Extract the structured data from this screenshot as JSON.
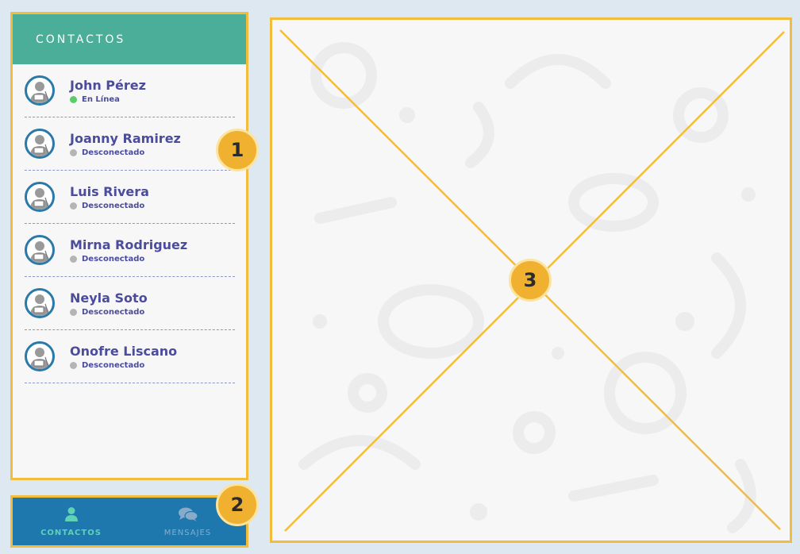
{
  "contacts": {
    "title": "CONTACTOS",
    "items": [
      {
        "name": "John Pérez",
        "status": "En Línea",
        "status_color": "#5ccb6a"
      },
      {
        "name": "Joanny Ramirez",
        "status": "Desconectado",
        "status_color": "#b5b5b5"
      },
      {
        "name": "Luis Rivera",
        "status": "Desconectado",
        "status_color": "#b5b5b5"
      },
      {
        "name": "Mirna Rodriguez",
        "status": "Desconectado",
        "status_color": "#b5b5b5"
      },
      {
        "name": "Neyla Soto",
        "status": "Desconectado",
        "status_color": "#b5b5b5"
      },
      {
        "name": "Onofre Liscano",
        "status": "Desconectado",
        "status_color": "#b5b5b5"
      }
    ]
  },
  "nav": {
    "contacts_label": "CONTACTOS",
    "contacts_icon": "user-icon",
    "messages_label": "MENSAJES",
    "messages_icon": "chat-bubbles-icon"
  },
  "badges": {
    "one": "1",
    "two": "2",
    "three": "3"
  },
  "colors": {
    "header": "#4bae98",
    "nav": "#1e78ae",
    "accent": "#f2bd3c",
    "name_text": "#4b4c9c",
    "avatar_ring": "#2a79a8"
  }
}
